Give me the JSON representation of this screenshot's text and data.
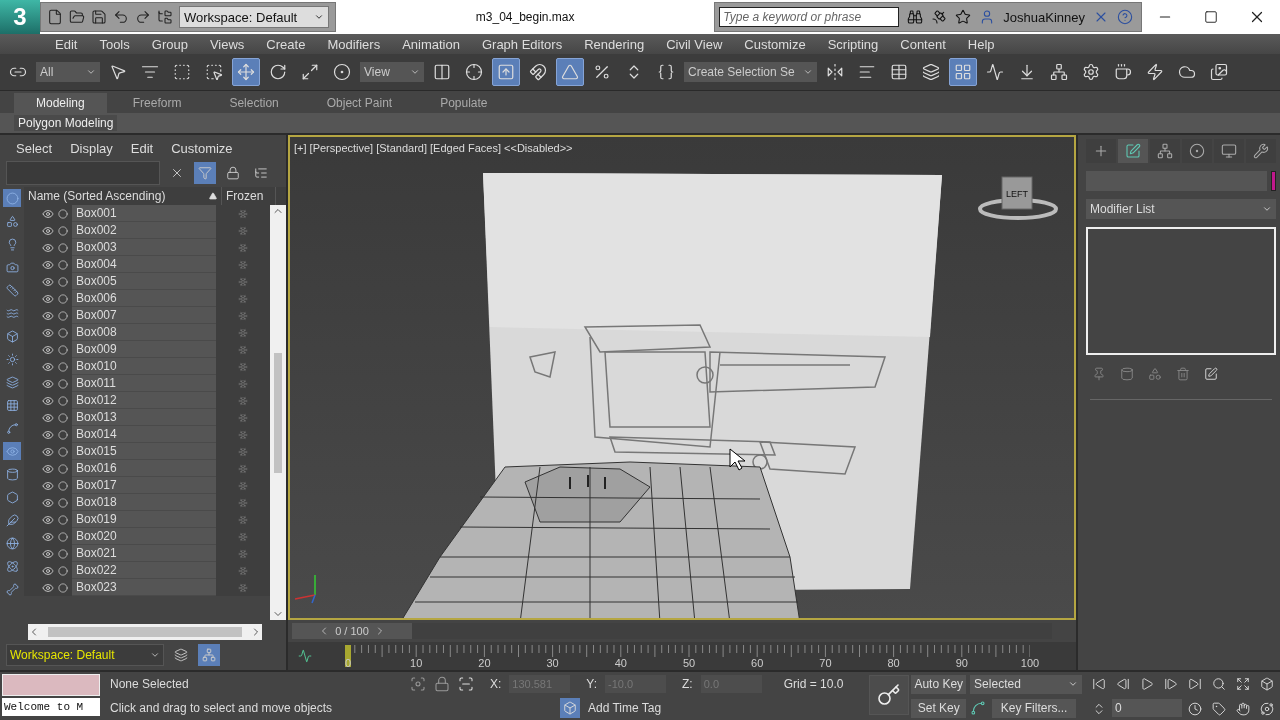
{
  "app_logo": "3",
  "quick_access": {
    "workspace": "Workspace: Default"
  },
  "title": "m3_04_begin.max",
  "search": {
    "placeholder": "Type a keyword or phrase"
  },
  "user": "JoshuaKinney",
  "menu": [
    "Edit",
    "Tools",
    "Group",
    "Views",
    "Create",
    "Modifiers",
    "Animation",
    "Graph Editors",
    "Rendering",
    "Civil View",
    "Customize",
    "Scripting",
    "Content",
    "Help"
  ],
  "toolbar": [
    {
      "kind": "button",
      "active": false
    },
    {
      "kind": "dropdown",
      "value": "All"
    },
    {
      "kind": "button",
      "active": false
    },
    {
      "kind": "button",
      "active": false
    },
    {
      "kind": "button",
      "active": false
    },
    {
      "kind": "button",
      "active": false
    },
    {
      "kind": "button",
      "active": true
    },
    {
      "kind": "button",
      "active": false
    },
    {
      "kind": "button",
      "active": false
    },
    {
      "kind": "button",
      "active": false
    },
    {
      "kind": "dropdown",
      "value": "View"
    },
    {
      "kind": "button",
      "active": false
    },
    {
      "kind": "button",
      "active": false
    },
    {
      "kind": "button",
      "active": true
    },
    {
      "kind": "button",
      "active": false
    },
    {
      "kind": "button",
      "active": true
    },
    {
      "kind": "button",
      "active": false
    },
    {
      "kind": "button",
      "active": false
    },
    {
      "kind": "button",
      "active": false
    },
    {
      "kind": "dropdown",
      "value": "Create Selection Se"
    },
    {
      "kind": "button",
      "active": false
    },
    {
      "kind": "button",
      "active": false
    },
    {
      "kind": "button",
      "active": false
    },
    {
      "kind": "button",
      "active": false
    },
    {
      "kind": "button",
      "active": true
    },
    {
      "kind": "button",
      "active": false
    },
    {
      "kind": "button",
      "active": false
    },
    {
      "kind": "button",
      "active": false
    },
    {
      "kind": "button",
      "active": false
    },
    {
      "kind": "button",
      "active": false
    },
    {
      "kind": "button",
      "active": false
    },
    {
      "kind": "button",
      "active": false
    },
    {
      "kind": "button",
      "active": false
    }
  ],
  "ribbon": {
    "tabs": [
      {
        "label": "Modeling",
        "selected": true
      },
      {
        "label": "Freeform",
        "selected": false
      },
      {
        "label": "Selection",
        "selected": false
      },
      {
        "label": "Object Paint",
        "selected": false
      },
      {
        "label": "Populate",
        "selected": false
      }
    ],
    "panel": "Polygon Modeling"
  },
  "explorer": {
    "menu": [
      "Select",
      "Display",
      "Edit",
      "Customize"
    ],
    "filter_on": true,
    "columns": [
      "Name (Sorted Ascending)",
      "Frozen"
    ],
    "rows": [
      "Box001",
      "Box002",
      "Box003",
      "Box004",
      "Box005",
      "Box006",
      "Box007",
      "Box008",
      "Box009",
      "Box010",
      "Box011",
      "Box012",
      "Box013",
      "Box014",
      "Box015",
      "Box016",
      "Box017",
      "Box018",
      "Box019",
      "Box020",
      "Box021",
      "Box022",
      "Box023"
    ],
    "strip": [
      {
        "active": true
      },
      {
        "active": false
      },
      {
        "active": false
      },
      {
        "active": false
      },
      {
        "active": false
      },
      {
        "active": false
      },
      {
        "active": false
      },
      {
        "active": false
      },
      {
        "active": false
      },
      {
        "active": false
      },
      {
        "active": false
      },
      {
        "active": true
      },
      {
        "active": false
      },
      {
        "active": false
      },
      {
        "active": false
      },
      {
        "active": false
      },
      {
        "active": false
      },
      {
        "active": false
      }
    ],
    "workspace": "Workspace: Default",
    "hierarchy_on": true
  },
  "viewport": {
    "label": "[+] [Perspective] [Standard] [Edged Faces] <<Disabled>>",
    "viewcube": "LEFT"
  },
  "time_slider": {
    "label": "0 / 100"
  },
  "track_labels": [
    "0",
    "10",
    "20",
    "30",
    "40",
    "50",
    "60",
    "70",
    "80",
    "90",
    "100"
  ],
  "command_panel": {
    "tabs": [
      {
        "selected": false
      },
      {
        "selected": true
      },
      {
        "selected": false
      },
      {
        "selected": false
      },
      {
        "selected": false
      },
      {
        "selected": false
      }
    ],
    "modifier_list": "Modifier List"
  },
  "status": {
    "listener": "Welcome to M",
    "selection": "None Selected",
    "prompt": "Click and drag to select and move objects",
    "coords": [
      {
        "label": "X:",
        "value": "130.581",
        "disabled": true
      },
      {
        "label": "Y:",
        "value": "-10.0",
        "disabled": true
      },
      {
        "label": "Z:",
        "value": "0.0",
        "disabled": true
      }
    ],
    "grid": "Grid = 10.0",
    "time_tag": "Add Time Tag",
    "auto_key": "Auto Key",
    "set_key": "Set Key",
    "key_mode": "Selected",
    "key_filters": "Key Filters...",
    "frame": "0"
  }
}
